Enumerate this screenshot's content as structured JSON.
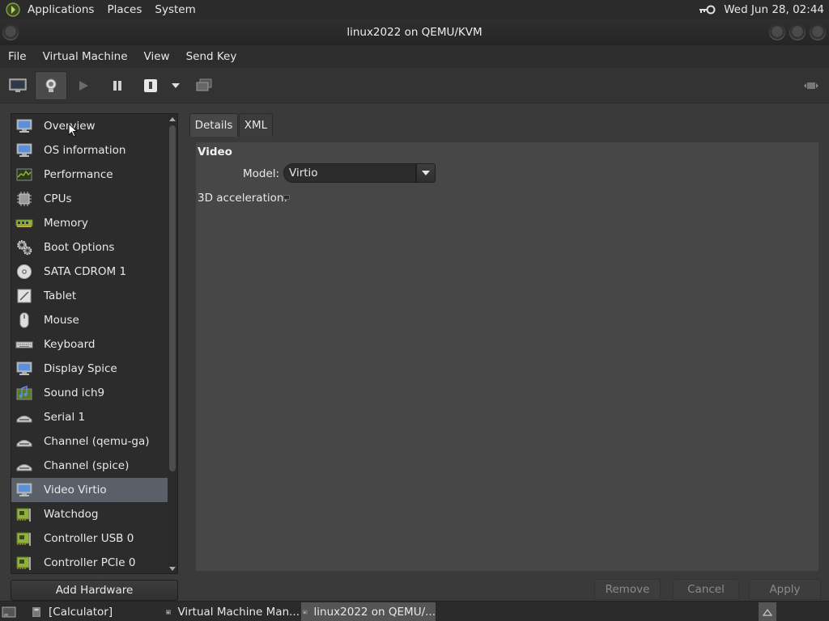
{
  "top_panel": {
    "menus": [
      "Applications",
      "Places",
      "System"
    ],
    "clock": "Wed Jun 28, 02:44"
  },
  "window": {
    "title": "linux2022 on QEMU/KVM"
  },
  "menubar": {
    "items": [
      "File",
      "Virtual Machine",
      "View",
      "Send Key"
    ]
  },
  "toolbar": {
    "icons": [
      "console-monitor-icon",
      "lightbulb-details-icon",
      "play-icon",
      "pause-icon",
      "power-icon",
      "dropdown-arrow-icon",
      "snapshot-icon",
      "fullscreen-icon"
    ]
  },
  "sidebar": {
    "items": [
      {
        "label": "Overview",
        "icon": "monitor-icon"
      },
      {
        "label": "OS information",
        "icon": "monitor-icon"
      },
      {
        "label": "Performance",
        "icon": "performance-graph-icon"
      },
      {
        "label": "CPUs",
        "icon": "cpu-chip-icon"
      },
      {
        "label": "Memory",
        "icon": "memory-stick-icon"
      },
      {
        "label": "Boot Options",
        "icon": "gears-icon"
      },
      {
        "label": "SATA CDROM 1",
        "icon": "cdrom-icon"
      },
      {
        "label": "Tablet",
        "icon": "tablet-icon"
      },
      {
        "label": "Mouse",
        "icon": "mouse-icon"
      },
      {
        "label": "Keyboard",
        "icon": "keyboard-icon"
      },
      {
        "label": "Display Spice",
        "icon": "monitor-icon"
      },
      {
        "label": "Sound ich9",
        "icon": "sound-icon"
      },
      {
        "label": "Serial 1",
        "icon": "serial-port-icon"
      },
      {
        "label": "Channel (qemu-ga)",
        "icon": "serial-port-icon"
      },
      {
        "label": "Channel (spice)",
        "icon": "serial-port-icon"
      },
      {
        "label": "Video Virtio",
        "icon": "monitor-icon",
        "selected": true
      },
      {
        "label": "Watchdog",
        "icon": "pci-card-icon"
      },
      {
        "label": "Controller USB 0",
        "icon": "pci-card-icon"
      },
      {
        "label": "Controller PCIe 0",
        "icon": "pci-card-icon"
      }
    ],
    "add_button": "Add Hardware"
  },
  "tabs": [
    {
      "label": "Details",
      "active": true
    },
    {
      "label": "XML",
      "active": false
    }
  ],
  "details": {
    "section_title": "Video",
    "model_label": "Model:",
    "model_value": "Virtio",
    "accel_label": "3D acceleration:",
    "accel_checked": false
  },
  "actions": {
    "remove": "Remove",
    "cancel": "Cancel",
    "apply": "Apply"
  },
  "taskbar": {
    "tasks": [
      {
        "label": "[Calculator]",
        "active": false
      },
      {
        "label": "Virtual Machine Man...",
        "active": false
      },
      {
        "label": "linux2022 on QEMU/...",
        "active": true
      }
    ]
  },
  "colors": {
    "panel_bg": "#2b2b2b",
    "content_bg": "#474747",
    "selection": "#5a5f68",
    "text": "#e8e8e8",
    "disabled_text": "#8a8a8a",
    "icon_green": "#8fb33a",
    "icon_blue": "#5b8fd6"
  }
}
